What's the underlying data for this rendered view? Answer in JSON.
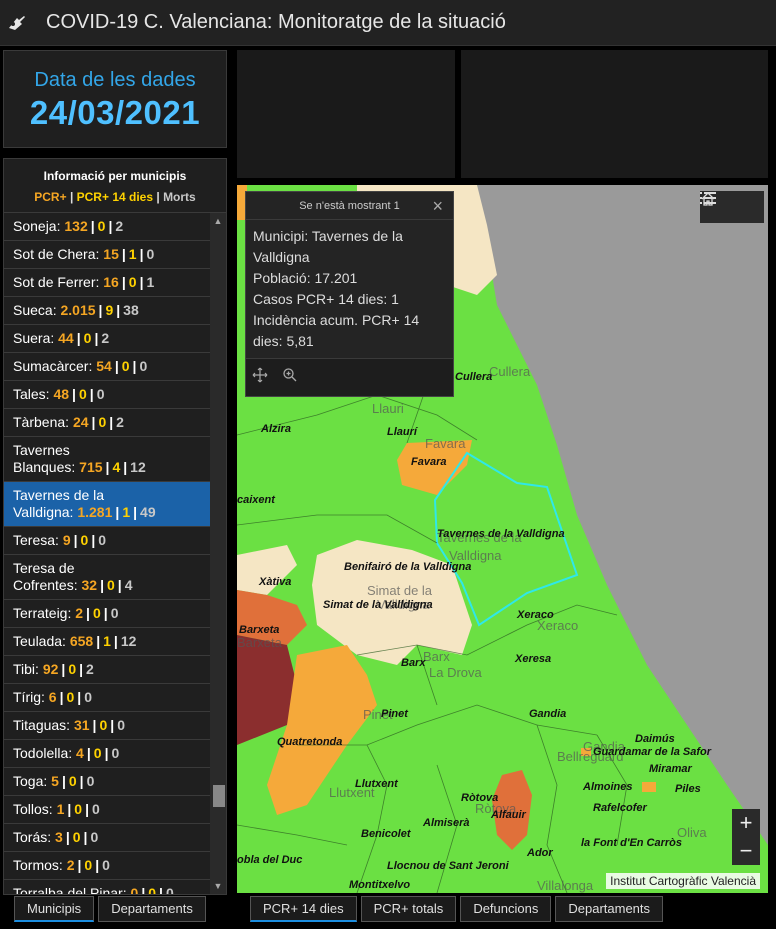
{
  "app": {
    "title": "COVID-19 C. Valenciana: Monitoratge de la situació"
  },
  "date_panel": {
    "label": "Data de les dades",
    "value": "24/03/2021"
  },
  "list": {
    "title": "Informació per municipis",
    "legend_pcr": "PCR+",
    "legend_sep1": "|",
    "legend_pcr14": "PCR+ 14 dies",
    "legend_sep2": "|",
    "legend_morts": "Morts",
    "rows": [
      {
        "name": "Soneja:",
        "pcr": "132",
        "pcr14": "0",
        "morts": "2"
      },
      {
        "name": "Sot de Chera:",
        "pcr": "15",
        "pcr14": "1",
        "morts": "0"
      },
      {
        "name": "Sot de Ferrer:",
        "pcr": "16",
        "pcr14": "0",
        "morts": "1"
      },
      {
        "name": "Sueca:",
        "pcr": "2.015",
        "pcr14": "9",
        "morts": "38"
      },
      {
        "name": "Suera:",
        "pcr": "44",
        "pcr14": "0",
        "morts": "2"
      },
      {
        "name": "Sumacàrcer:",
        "pcr": "54",
        "pcr14": "0",
        "morts": "0"
      },
      {
        "name": "Tales:",
        "pcr": "48",
        "pcr14": "0",
        "morts": "0"
      },
      {
        "name": "Tàrbena:",
        "pcr": "24",
        "pcr14": "0",
        "morts": "2"
      },
      {
        "name_l1": "Tavernes",
        "name": "Blanques:",
        "pcr": "715",
        "pcr14": "4",
        "morts": "12"
      },
      {
        "name_l1": "Tavernes de la",
        "name": "Valldigna:",
        "pcr": "1.281",
        "pcr14": "1",
        "morts": "49",
        "selected": true
      },
      {
        "name": "Teresa:",
        "pcr": "9",
        "pcr14": "0",
        "morts": "0"
      },
      {
        "name_l1": "Teresa de",
        "name": "Cofrentes:",
        "pcr": "32",
        "pcr14": "0",
        "morts": "4"
      },
      {
        "name": "Terrateig:",
        "pcr": "2",
        "pcr14": "0",
        "morts": "0"
      },
      {
        "name": "Teulada:",
        "pcr": "658",
        "pcr14": "1",
        "morts": "12"
      },
      {
        "name": "Tibi:",
        "pcr": "92",
        "pcr14": "0",
        "morts": "2"
      },
      {
        "name": "Tírig:",
        "pcr": "6",
        "pcr14": "0",
        "morts": "0"
      },
      {
        "name": "Titaguas:",
        "pcr": "31",
        "pcr14": "0",
        "morts": "0"
      },
      {
        "name": "Todolella:",
        "pcr": "4",
        "pcr14": "0",
        "morts": "0"
      },
      {
        "name": "Toga:",
        "pcr": "5",
        "pcr14": "0",
        "morts": "0"
      },
      {
        "name": "Tollos:",
        "pcr": "1",
        "pcr14": "0",
        "morts": "0"
      },
      {
        "name": "Torás:",
        "pcr": "3",
        "pcr14": "0",
        "morts": "0"
      },
      {
        "name": "Tormos:",
        "pcr": "2",
        "pcr14": "0",
        "morts": "0"
      },
      {
        "name": "Torralba del Pinar:",
        "pcr": "0",
        "pcr14": "0",
        "morts": "0"
      }
    ]
  },
  "left_tabs": [
    "Municipis",
    "Departaments"
  ],
  "map_tabs": [
    "PCR+ 14 dies",
    "PCR+ totals",
    "Defuncions",
    "Departaments"
  ],
  "popup": {
    "title": "Se n'està mostrant 1",
    "line1": "Municipi: Tavernes de la",
    "line2": "Valldigna",
    "line3": "Població: 17.201",
    "line4": "Casos PCR+ 14 dies: 1",
    "line5": "Incidència acum. PCR+ 14",
    "line6": "dies: 5,81"
  },
  "map": {
    "attribution": "Institut Cartogràfic Valencià",
    "zoom_in": "+",
    "zoom_out": "−",
    "labels_bold": [
      "Cullera",
      "Llaurí",
      "Alzira",
      "Favara",
      "Tavernes de la Valldigna",
      "Benifairó de la Valldigna",
      "Xàtiva",
      "Simat de la Valldigna",
      "Xeraco",
      "Barx",
      "Xeresa",
      "Pinet",
      "Gandia",
      "Quatretonda",
      "Daimús",
      "Guardamar de la Safor",
      "Miramar",
      "Almoines",
      "Piles",
      "Llutxent",
      "Ròtova",
      "Rafelcofer",
      "Almiserà",
      "Alfauir",
      "Benicolet",
      "la Font d'En Carròs",
      "Llocnou de Sant Jeroni",
      "Ador",
      "Montitxelvo",
      "Barxeta",
      "caixent",
      "obla del Duc"
    ],
    "labels_faint": [
      "Cullera",
      "Llauri",
      "Favara",
      "Tavernes de la",
      "Valldigna",
      "Simat de la",
      "Valldigna",
      "Xeraco",
      "Barx",
      "La Drova",
      "Pinet",
      "Gandia",
      "Bellreguard",
      "Llutxent",
      "Ròtova",
      "Oliva",
      "Barxeta",
      "Villalonga"
    ]
  },
  "colors": {
    "green": "#6be043",
    "orange": "#f5a93a",
    "cream": "#f5e6c4",
    "dark_orange": "#e0703a",
    "dark_red": "#8b2e2e",
    "sea": "#9a9a9a",
    "accent": "#1b8de0",
    "selected_row": "#1b62a8",
    "highlight_outline": "#2fe8e8"
  }
}
